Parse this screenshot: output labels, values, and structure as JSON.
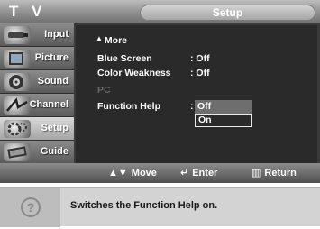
{
  "header": {
    "tv_label": "T V",
    "title": "Setup"
  },
  "nav": {
    "items": [
      {
        "label": "Input",
        "icon": "input-icon",
        "active": false
      },
      {
        "label": "Picture",
        "icon": "picture-icon",
        "active": false
      },
      {
        "label": "Sound",
        "icon": "sound-icon",
        "active": false
      },
      {
        "label": "Channel",
        "icon": "channel-icon",
        "active": false
      },
      {
        "label": "Setup",
        "icon": "setup-icon",
        "active": true
      },
      {
        "label": "Guide",
        "icon": "guide-icon",
        "active": false
      }
    ]
  },
  "menu": {
    "more_label": "More",
    "items": [
      {
        "label": "Blue Screen",
        "value": ": Off",
        "enabled": true
      },
      {
        "label": "Color Weakness",
        "value": ": Off",
        "enabled": true
      },
      {
        "label": "PC",
        "value": "",
        "enabled": false
      },
      {
        "label": "Function Help",
        "value": ":",
        "enabled": true
      }
    ],
    "dropdown": {
      "options": [
        "Off",
        "On"
      ],
      "highlighted": "Off",
      "selected": "On"
    }
  },
  "footer": {
    "move": "Move",
    "enter": "Enter",
    "return": "Return"
  },
  "help": {
    "text": "Switches the Function Help on."
  }
}
